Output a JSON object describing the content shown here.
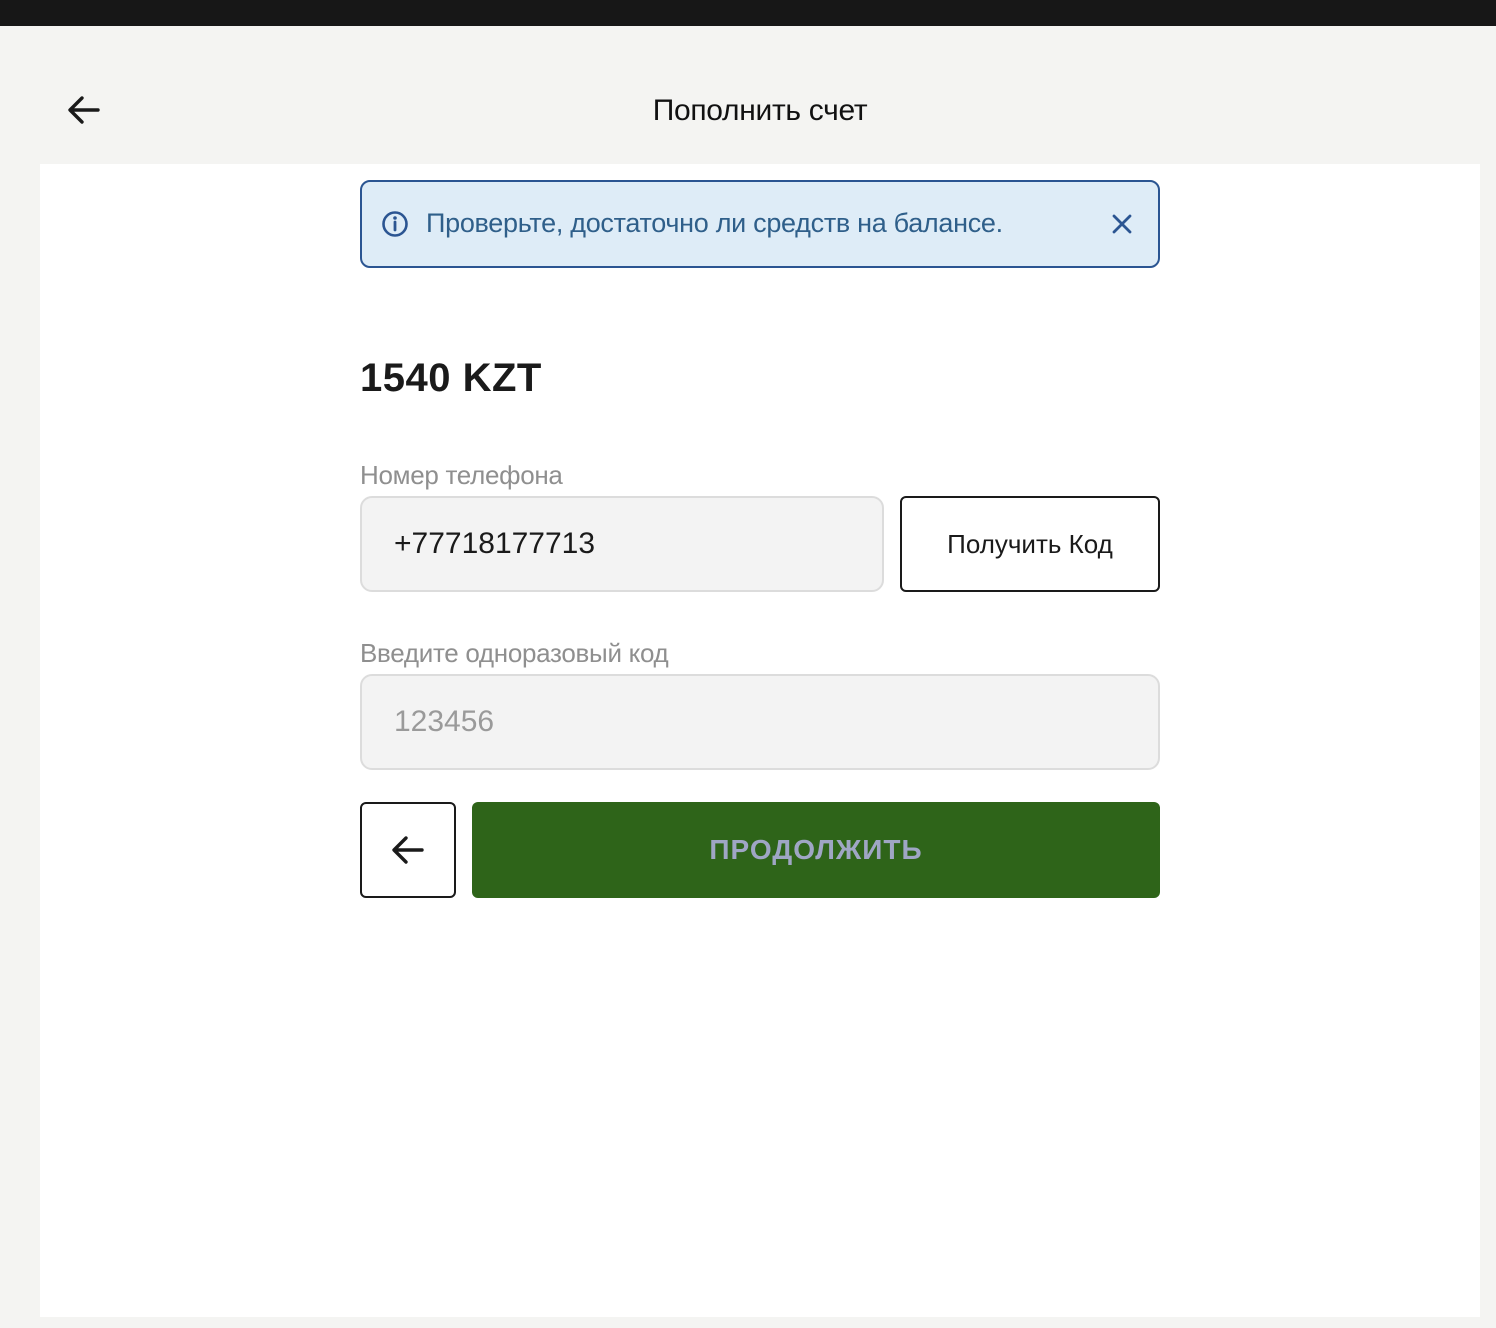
{
  "header": {
    "title": "Пополнить счет",
    "back_icon": "arrow-left-icon"
  },
  "alert": {
    "text": "Проверьте, достаточно ли средств на балансе.",
    "info_icon": "info-circle-icon",
    "close_icon": "close-icon",
    "colors": {
      "background": "#deecf7",
      "border": "#2b5592",
      "text": "#2f5f8a"
    }
  },
  "form": {
    "amount": "1540 KZT",
    "phone_label": "Номер телефона",
    "phone_value": "+77718177713",
    "get_code_label": "Получить Код",
    "code_label": "Введите одноразовый код",
    "code_placeholder": "123456",
    "back_icon": "arrow-left-icon",
    "continue_label": "ПРОДОЛЖИТЬ",
    "colors": {
      "continue_bg": "#2e6419",
      "continue_text": "#9fa6c4"
    }
  }
}
